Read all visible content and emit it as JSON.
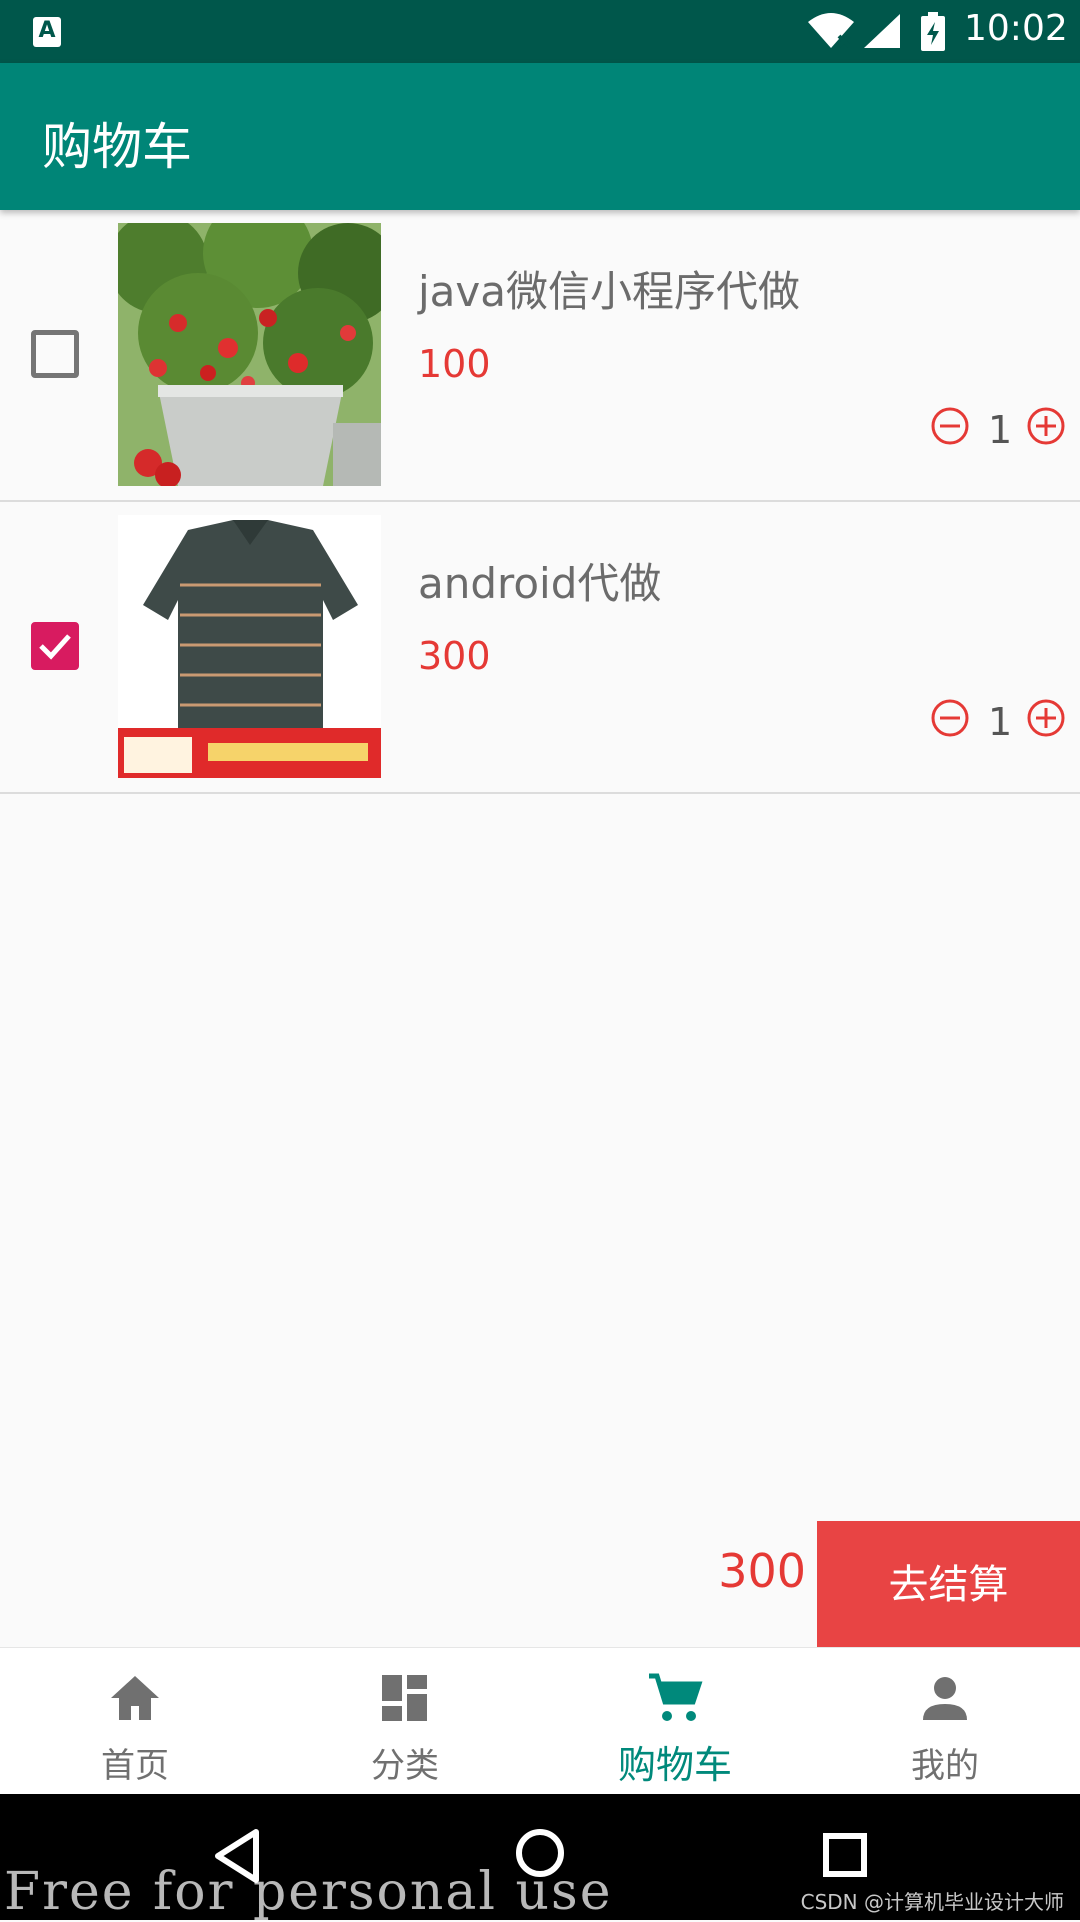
{
  "status_bar": {
    "app_badge": "A",
    "time": "10:02",
    "icons": [
      "notification-a-icon",
      "wifi-icon",
      "signal-icon",
      "battery-charging-icon"
    ]
  },
  "app_bar": {
    "title": "购物车"
  },
  "cart_items": [
    {
      "name": "java微信小程序代做",
      "price": "100",
      "quantity": "1",
      "checked": false,
      "image": "strawberry-plant-photo"
    },
    {
      "name": "android代做",
      "price": "300",
      "quantity": "1",
      "checked": true,
      "image": "striped-polo-shirt-photo"
    }
  ],
  "footer": {
    "total": "300",
    "checkout_label": "去结算"
  },
  "bottom_nav": {
    "items": [
      {
        "label": "首页",
        "icon": "home-icon",
        "active": false
      },
      {
        "label": "分类",
        "icon": "dashboard-icon",
        "active": false
      },
      {
        "label": "购物车",
        "icon": "cart-icon",
        "active": true
      },
      {
        "label": "我的",
        "icon": "person-icon",
        "active": false
      }
    ]
  },
  "overlay": {
    "watermark": "Free for personal use",
    "credit": "CSDN @计算机毕业设计大师"
  },
  "colors": {
    "primary": "#008577",
    "primary_dark": "#00574b",
    "accent": "#d81b60",
    "price_red": "#e53935",
    "checkout_red": "#e84444"
  }
}
